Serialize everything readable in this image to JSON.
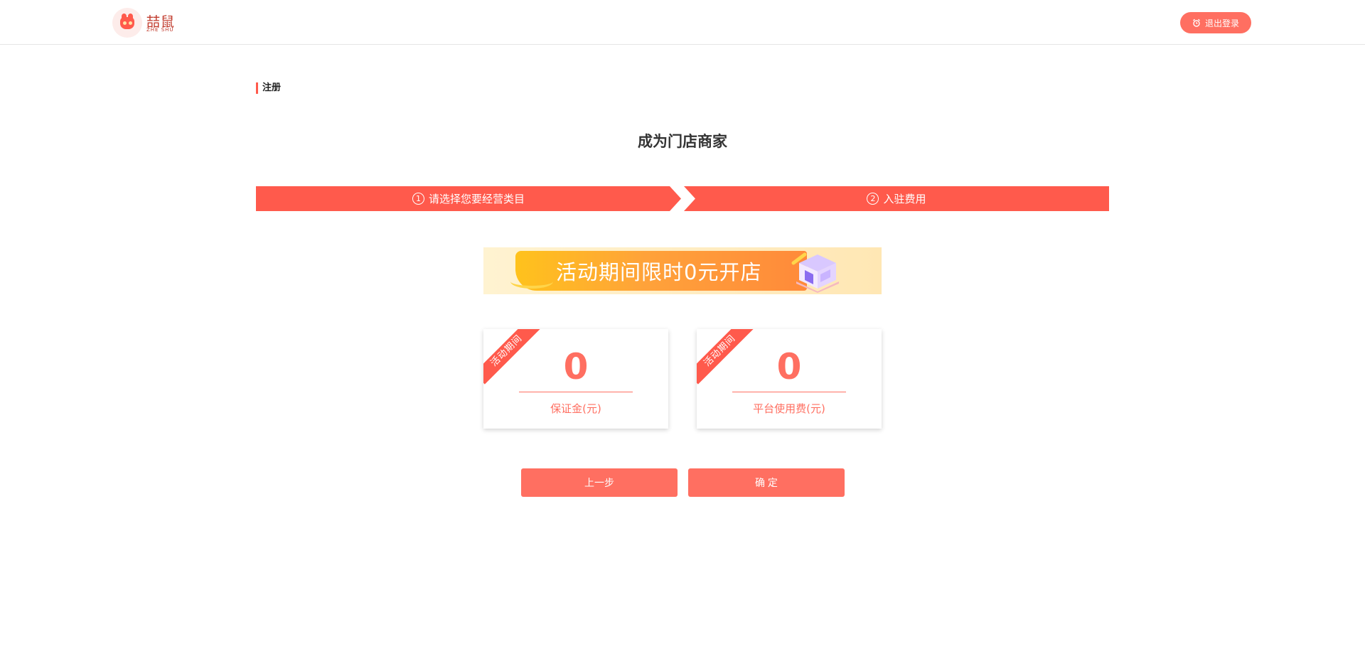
{
  "header": {
    "logo_cn": "喆鼠",
    "logo_en": "ZHE SHU",
    "logout_label": "退出登录",
    "logout_icon": "alarm-clock-icon"
  },
  "section": {
    "title": "注册"
  },
  "page": {
    "title": "成为门店商家"
  },
  "steps": [
    {
      "number": "1",
      "label": "请选择您要经营类目"
    },
    {
      "number": "2",
      "label": "入驻费用"
    }
  ],
  "banner": {
    "text": "活动期间限时0元开店",
    "icon": "storefront-icon"
  },
  "cards": [
    {
      "ribbon": "活动期间",
      "value": "0",
      "label": "保证金(元)"
    },
    {
      "ribbon": "活动期间",
      "value": "0",
      "label": "平台使用费(元)"
    }
  ],
  "buttons": {
    "prev": "上一步",
    "confirm": "确 定"
  },
  "colors": {
    "accent": "#ff5a4c",
    "button": "#ff6f61",
    "banner_bg": "#fff3d1",
    "banner_strip": "#ffa23a"
  }
}
